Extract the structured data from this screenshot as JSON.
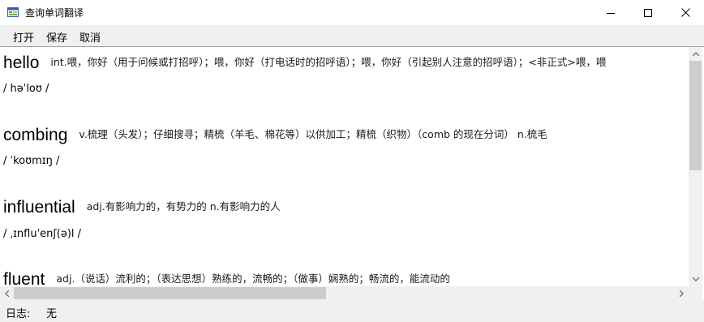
{
  "window": {
    "title": "查询单词翻译",
    "icons": {
      "app": "winforms-app-icon",
      "minimize": "minimize-icon",
      "maximize": "maximize-icon",
      "close": "close-icon"
    }
  },
  "menu": {
    "open": "打开",
    "save": "保存",
    "cancel": "取消"
  },
  "entries": [
    {
      "word": "hello",
      "definition": "int.喂，你好（用于问候或打招呼）；喂，你好（打电话时的招呼语）；喂，你好（引起别人注意的招呼语）；<非正式>喂，喂",
      "phonetic": "/ həˈloʊ /"
    },
    {
      "word": "combing",
      "definition": "v.梳理（头发）；仔细搜寻；精梳（羊毛、棉花等）以供加工；精梳（织物）（comb 的现在分词）          n.梳毛",
      "phonetic": "/ ˈkoʊmɪŋ /"
    },
    {
      "word": "influential",
      "definition": "adj.有影响力的，有势力的 n.有影响力的人",
      "phonetic": "/ ˌɪnfluˈenʃ(ə)l /"
    },
    {
      "word": "fluent",
      "definition": "adj.（说话）流利的；（表达思想）熟练的，流畅的；（做事）娴熟的；畅流的，能流动的",
      "phonetic": ""
    }
  ],
  "status": {
    "label": "日志:",
    "value": "无"
  },
  "scroll_icons": {
    "up": "arrow-up-icon",
    "down": "arrow-down-icon",
    "left": "arrow-left-icon",
    "right": "arrow-right-icon"
  }
}
